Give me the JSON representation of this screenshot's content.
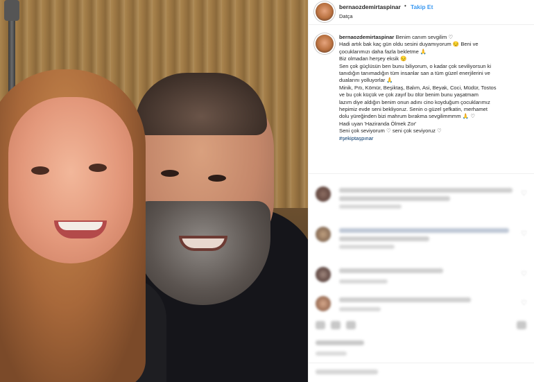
{
  "post": {
    "username": "bernaozdemirtaspinar",
    "separator": "•",
    "follow_label": "Takip Et",
    "location": "Datça"
  },
  "caption": {
    "username": "bernaozdemirtaspinar",
    "lines": [
      "Benim canım sevgilim ♡",
      "Hadi artık bak kaç gün oldu sesini duyamıyorum 😔 Beni ve",
      "çocuklarımızı daha fazla bekletme 🙏",
      "Biz olmadan herşey eksik 😔",
      "Sen çok güçlüsün ben bunu biliyorum, o kadar çok seviliyorsun ki",
      "tanıdığın tanımadığın tüm insanlar san a tüm güzel enerjilerini ve",
      "dualarını yolluyorlar 🙏",
      "Minik, Pıtı, Kömür, Beşiktaş, Balım, Asi, Beyak, Coci, Müdür, Tostos",
      "ve bu çok küçük ve çok zayıf bu ölür benim bunu yaşatmam",
      "lazım diye aldığın benim onun adını cino koyduğum çocuklarımız",
      "hepimiz evde seni bekliyoruz. Senin o güzel şefkatin, merhamet",
      "dolu yüreğinden bizi mahrum bırakma sevgilimmmm 🙏 ♡",
      "Hadi uyan 'Haziranda Ölmek Zor'",
      "Seni çok seviyorum ♡ seni çok seviyoruz ♡"
    ],
    "hashtag": "#şekiptaşpınar"
  },
  "colors": {
    "link": "#3897f0",
    "hashtag": "#003569",
    "text": "#262626",
    "border": "#efefef"
  }
}
